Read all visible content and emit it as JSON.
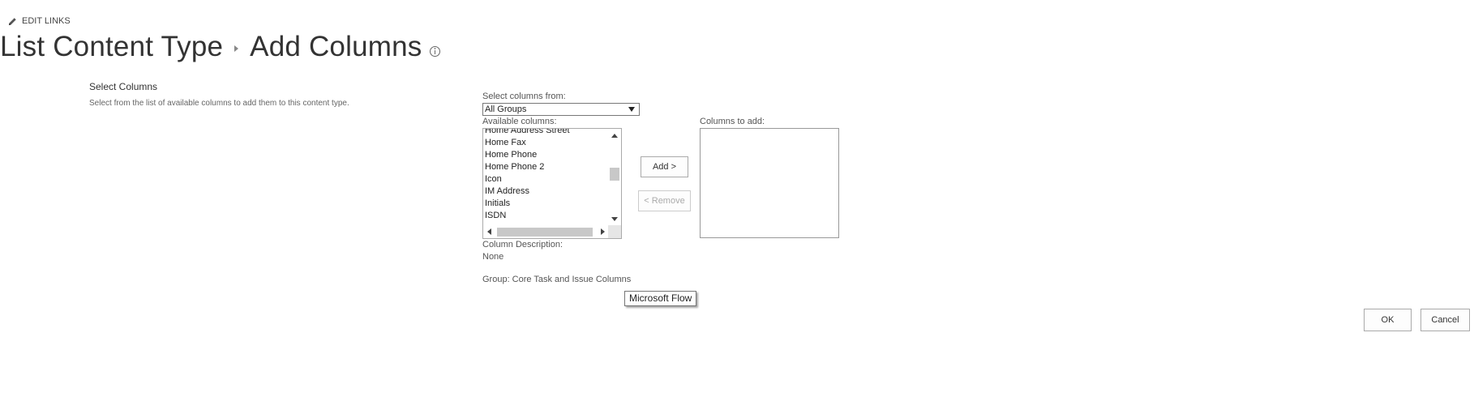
{
  "header": {
    "edit_links": "EDIT LINKS",
    "breadcrumb": [
      "List Content Type",
      "Add Columns"
    ]
  },
  "section": {
    "title": "Select Columns",
    "description": "Select from the list of available columns to add them to this content type."
  },
  "form": {
    "select_from_label": "Select columns from:",
    "select_from_value": "All Groups",
    "available_label": "Available columns:",
    "available_items": [
      "Home Address Street",
      "Home Fax",
      "Home Phone",
      "Home Phone 2",
      "Icon",
      "IM Address",
      "Initials",
      "ISDN"
    ],
    "add_button": "Add >",
    "remove_button": "< Remove",
    "columns_to_add_label": "Columns to add:",
    "column_description_label": "Column Description:",
    "column_description_value": "None",
    "group_text": "Group: Core Task and Issue Columns"
  },
  "tooltip": "Microsoft Flow",
  "footer": {
    "ok_button": "OK",
    "cancel_button": "Cancel"
  },
  "icons": {
    "edit": "pencil-icon",
    "info": "info-icon",
    "separator": "chevron-right-icon"
  }
}
